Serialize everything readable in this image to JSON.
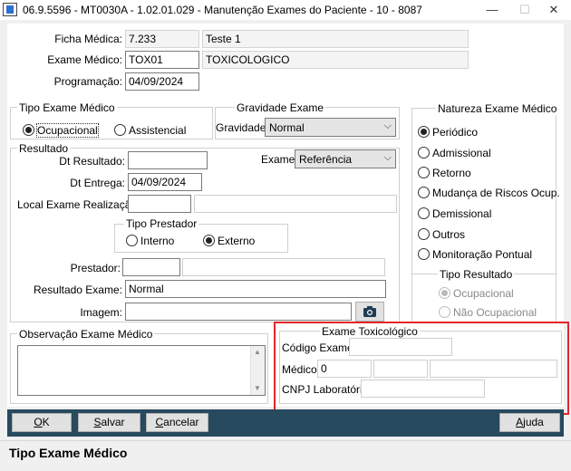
{
  "window": {
    "title": "06.9.5596 - MT0030A - 1.02.01.029 - Manutenção Exames do Paciente - 10 - 8087",
    "minimize": "—",
    "maximize": "☐",
    "close": "✕"
  },
  "header": {
    "ficha_label": "Ficha Médica:",
    "ficha_value": "7.233",
    "ficha_name": "Teste 1",
    "exame_label": "Exame Médico:",
    "exame_code": "TOX01",
    "exame_name": "TOXICOLOGICO",
    "programacao_label": "Programação:",
    "programacao_value": "04/09/2024"
  },
  "tipo_exame": {
    "legend": "Tipo Exame Médico",
    "ocupacional": "Ocupacional",
    "assistencial": "Assistencial",
    "selected": "ocupacional"
  },
  "gravidade": {
    "legend": "Gravidade Exame",
    "label": "Gravidade:",
    "value": "Normal"
  },
  "resultado": {
    "legend": "Resultado",
    "dt_resultado_label": "Dt Resultado:",
    "dt_resultado_value": "",
    "dt_entrega_label": "Dt Entrega:",
    "dt_entrega_value": "04/09/2024",
    "exame_label": "Exame:",
    "exame_value": "Referência",
    "local_label": "Local Exame Realização:",
    "tipo_prestador_legend": "Tipo Prestador",
    "interno": "Interno",
    "externo": "Externo",
    "prestador_label": "Prestador:",
    "resultado_exame_label": "Resultado Exame:",
    "resultado_exame_value": "Normal",
    "imagem_label": "Imagem:"
  },
  "natureza": {
    "legend": "Natureza Exame Médico",
    "options": [
      "Periódico",
      "Admissional",
      "Retorno",
      "Mudança de Riscos Ocup.",
      "Demissional",
      "Outros",
      "Monitoração Pontual"
    ],
    "tipo_resultado_legend": "Tipo Resultado",
    "ocupacional": "Ocupacional",
    "nao_ocupacional": "Não Ocupacional"
  },
  "observacao": {
    "legend": "Observação Exame Médico"
  },
  "toxicologico": {
    "legend": "Exame Toxicológico",
    "codigo_label": "Código Exame:",
    "medico_label": "Médico:",
    "medico_value": "0",
    "cnpj_label": "CNPJ Laboratório:"
  },
  "buttons": {
    "ok_u": "O",
    "ok_rest": "K",
    "salvar_u": "S",
    "salvar_rest": "alvar",
    "cancelar_u": "C",
    "cancelar_rest": "ancelar",
    "ajuda_u": "A",
    "ajuda_rest": "juda"
  },
  "status": {
    "text": "Tipo Exame Médico"
  },
  "colors": {
    "highlight": "#e2262a",
    "button_bar": "#274a5e"
  }
}
